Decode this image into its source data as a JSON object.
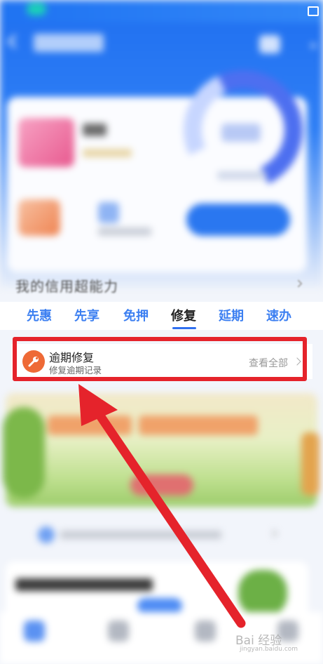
{
  "section": {
    "title": "我的信用超能力"
  },
  "tabs": [
    {
      "label": "先惠",
      "active": false
    },
    {
      "label": "先享",
      "active": false
    },
    {
      "label": "免押",
      "active": false
    },
    {
      "label": "修复",
      "active": true
    },
    {
      "label": "延期",
      "active": false
    },
    {
      "label": "速办",
      "active": false
    }
  ],
  "repair_item": {
    "title": "逾期修复",
    "subtitle": "修复逾期记录",
    "link": "查看全部",
    "icon": "wrench-icon"
  },
  "annotation": {
    "color": "#e5232b"
  },
  "colors": {
    "accent": "#3c7ff1",
    "icon_bg": "#ee6a36"
  },
  "watermark": {
    "text": "Bai 经验",
    "sub": "jingyan.baidu.com"
  }
}
